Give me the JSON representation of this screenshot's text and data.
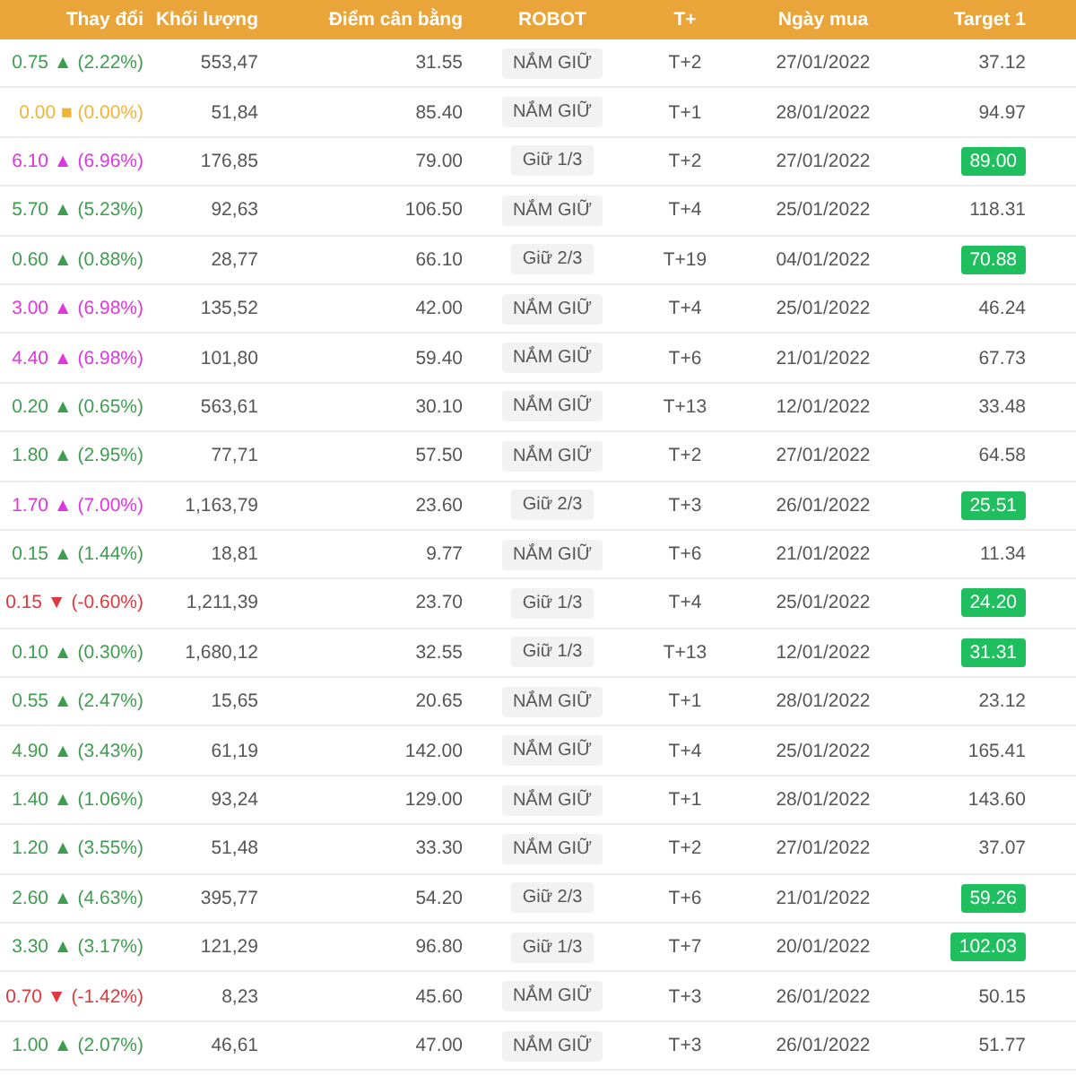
{
  "table": {
    "columns": [
      "Thay đổi",
      "Khối lượng",
      "Điểm cân bằng",
      "ROBOT",
      "T+",
      "Ngày mua",
      "Target 1"
    ],
    "rows": [
      {
        "change": "0.75 ▲ (2.22%)",
        "color": "#3f9d50",
        "volume": "553,47",
        "balance": "31.55",
        "robot": "NẮM GIỮ",
        "t": "T+2",
        "date": "27/01/2022",
        "target": "37.12",
        "hit": false
      },
      {
        "change": "0.00 ■ (0.00%)",
        "color": "#f0b43a",
        "volume": "51,84",
        "balance": "85.40",
        "robot": "NẮM GIỮ",
        "t": "T+1",
        "date": "28/01/2022",
        "target": "94.97",
        "hit": false
      },
      {
        "change": "6.10 ▲ (6.96%)",
        "color": "#e036e0",
        "volume": "176,85",
        "balance": "79.00",
        "robot": "Giữ 1/3",
        "t": "T+2",
        "date": "27/01/2022",
        "target": "89.00",
        "hit": true
      },
      {
        "change": "5.70 ▲ (5.23%)",
        "color": "#3f9d50",
        "volume": "92,63",
        "balance": "106.50",
        "robot": "NẮM GIỮ",
        "t": "T+4",
        "date": "25/01/2022",
        "target": "118.31",
        "hit": false
      },
      {
        "change": "0.60 ▲ (0.88%)",
        "color": "#3f9d50",
        "volume": "28,77",
        "balance": "66.10",
        "robot": "Giữ 2/3",
        "t": "T+19",
        "date": "04/01/2022",
        "target": "70.88",
        "hit": true
      },
      {
        "change": "3.00 ▲ (6.98%)",
        "color": "#e036e0",
        "volume": "135,52",
        "balance": "42.00",
        "robot": "NẮM GIỮ",
        "t": "T+4",
        "date": "25/01/2022",
        "target": "46.24",
        "hit": false
      },
      {
        "change": "4.40 ▲ (6.98%)",
        "color": "#e036e0",
        "volume": "101,80",
        "balance": "59.40",
        "robot": "NẮM GIỮ",
        "t": "T+6",
        "date": "21/01/2022",
        "target": "67.73",
        "hit": false
      },
      {
        "change": "0.20 ▲ (0.65%)",
        "color": "#3f9d50",
        "volume": "563,61",
        "balance": "30.10",
        "robot": "NẮM GIỮ",
        "t": "T+13",
        "date": "12/01/2022",
        "target": "33.48",
        "hit": false
      },
      {
        "change": "1.80 ▲ (2.95%)",
        "color": "#3f9d50",
        "volume": "77,71",
        "balance": "57.50",
        "robot": "NẮM GIỮ",
        "t": "T+2",
        "date": "27/01/2022",
        "target": "64.58",
        "hit": false
      },
      {
        "change": "1.70 ▲ (7.00%)",
        "color": "#e036e0",
        "volume": "1,163,79",
        "balance": "23.60",
        "robot": "Giữ 2/3",
        "t": "T+3",
        "date": "26/01/2022",
        "target": "25.51",
        "hit": true
      },
      {
        "change": "0.15 ▲ (1.44%)",
        "color": "#3f9d50",
        "volume": "18,81",
        "balance": "9.77",
        "robot": "NẮM GIỮ",
        "t": "T+6",
        "date": "21/01/2022",
        "target": "11.34",
        "hit": false
      },
      {
        "change": "0.15 ▼ (-0.60%)",
        "color": "#e0383e",
        "volume": "1,211,39",
        "balance": "23.70",
        "robot": "Giữ 1/3",
        "t": "T+4",
        "date": "25/01/2022",
        "target": "24.20",
        "hit": true
      },
      {
        "change": "0.10 ▲ (0.30%)",
        "color": "#3f9d50",
        "volume": "1,680,12",
        "balance": "32.55",
        "robot": "Giữ 1/3",
        "t": "T+13",
        "date": "12/01/2022",
        "target": "31.31",
        "hit": true
      },
      {
        "change": "0.55 ▲ (2.47%)",
        "color": "#3f9d50",
        "volume": "15,65",
        "balance": "20.65",
        "robot": "NẮM GIỮ",
        "t": "T+1",
        "date": "28/01/2022",
        "target": "23.12",
        "hit": false
      },
      {
        "change": "4.90 ▲ (3.43%)",
        "color": "#3f9d50",
        "volume": "61,19",
        "balance": "142.00",
        "robot": "NẮM GIỮ",
        "t": "T+4",
        "date": "25/01/2022",
        "target": "165.41",
        "hit": false
      },
      {
        "change": "1.40 ▲ (1.06%)",
        "color": "#3f9d50",
        "volume": "93,24",
        "balance": "129.00",
        "robot": "NẮM GIỮ",
        "t": "T+1",
        "date": "28/01/2022",
        "target": "143.60",
        "hit": false
      },
      {
        "change": "1.20 ▲ (3.55%)",
        "color": "#3f9d50",
        "volume": "51,48",
        "balance": "33.30",
        "robot": "NẮM GIỮ",
        "t": "T+2",
        "date": "27/01/2022",
        "target": "37.07",
        "hit": false
      },
      {
        "change": "2.60 ▲ (4.63%)",
        "color": "#3f9d50",
        "volume": "395,77",
        "balance": "54.20",
        "robot": "Giữ 2/3",
        "t": "T+6",
        "date": "21/01/2022",
        "target": "59.26",
        "hit": true
      },
      {
        "change": "3.30 ▲ (3.17%)",
        "color": "#3f9d50",
        "volume": "121,29",
        "balance": "96.80",
        "robot": "Giữ 1/3",
        "t": "T+7",
        "date": "20/01/2022",
        "target": "102.03",
        "hit": true
      },
      {
        "change": "0.70 ▼ (-1.42%)",
        "color": "#e0383e",
        "volume": "8,23",
        "balance": "45.60",
        "robot": "NẮM GIỮ",
        "t": "T+3",
        "date": "26/01/2022",
        "target": "50.15",
        "hit": false
      },
      {
        "change": "1.00 ▲ (2.07%)",
        "color": "#3f9d50",
        "volume": "46,61",
        "balance": "47.00",
        "robot": "NẮM GIỮ",
        "t": "T+3",
        "date": "26/01/2022",
        "target": "51.77",
        "hit": false
      }
    ]
  }
}
